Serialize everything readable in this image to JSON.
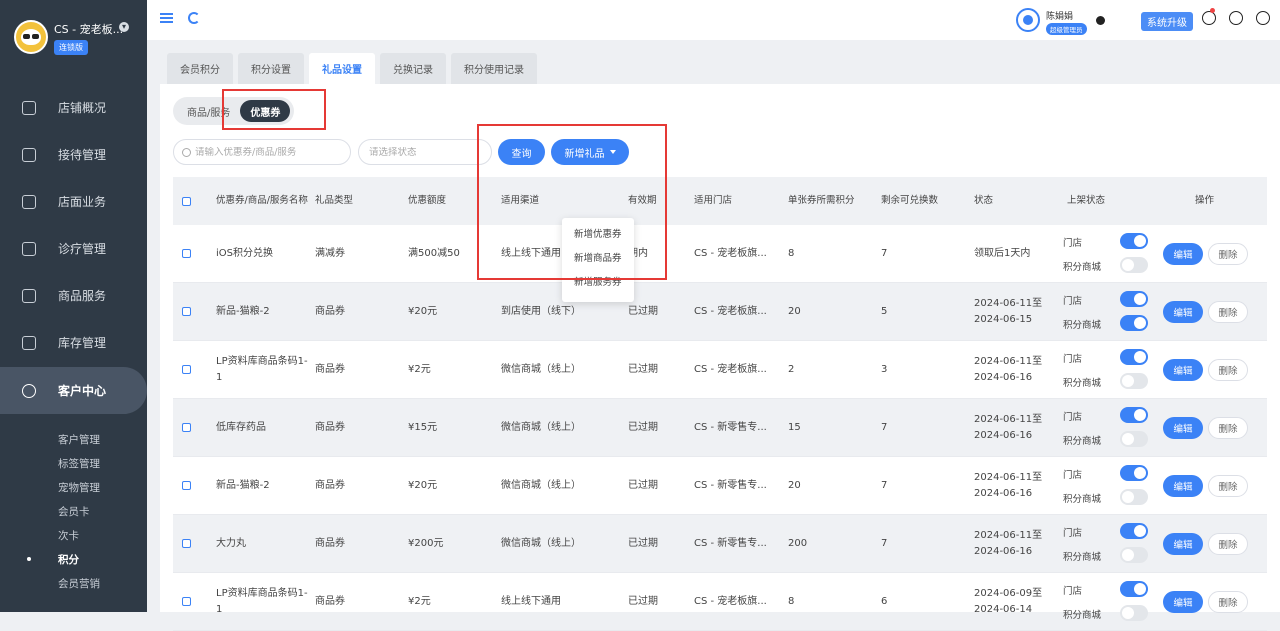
{
  "sidebar": {
    "store_name": "CS - 宠老板...",
    "chain_badge": "连锁版",
    "nav": [
      {
        "label": "店铺概况",
        "icon": "monitor-icon"
      },
      {
        "label": "接待管理",
        "icon": "clipboard-icon"
      },
      {
        "label": "店面业务",
        "icon": "home-icon"
      },
      {
        "label": "诊疗管理",
        "icon": "medical-kit-icon"
      },
      {
        "label": "商品服务",
        "icon": "shopping-bag-icon"
      },
      {
        "label": "库存管理",
        "icon": "box-icon"
      },
      {
        "label": "客户中心",
        "icon": "customer-icon"
      }
    ],
    "sub_items": [
      "客户管理",
      "标签管理",
      "宠物管理",
      "会员卡",
      "次卡",
      "积分",
      "会员营销"
    ]
  },
  "topbar": {
    "user_name": "陈娟娟",
    "user_role": "超级管理员",
    "upgrade_label": "系统升级"
  },
  "tabs": [
    "会员积分",
    "积分设置",
    "礼品设置",
    "兑换记录",
    "积分使用记录"
  ],
  "segment": [
    "商品/服务",
    "优惠券"
  ],
  "filters": {
    "search_placeholder": "请输入优惠券/商品/服务",
    "status_placeholder": "请选择状态",
    "query_label": "查询",
    "add_gift_label": "新增礼品"
  },
  "dropdown": [
    "新增优惠券",
    "新增商品券",
    "新增服务券"
  ],
  "table": {
    "headers": [
      "优惠券/商品/服务名称",
      "礼品类型",
      "优惠额度",
      "适用渠道",
      "有效期",
      "适用门店",
      "单张券所需积分",
      "剩余可兑换数",
      "状态",
      "上架状态",
      "操作"
    ],
    "row_labels": {
      "store": "门店",
      "mall": "积分商城",
      "edit": "编辑",
      "delete": "删除"
    },
    "rows": [
      {
        "name": "iOS积分兑换",
        "type": "满减券",
        "amount": "满500减50",
        "channel": "线上线下通用",
        "validity": "期内",
        "store": "CS - 宠老板旗...",
        "points": "8",
        "remaining": "7",
        "status": "领取后1天内",
        "store_on": true,
        "mall_on": false
      },
      {
        "name": "新品-猫粮-2",
        "type": "商品券",
        "amount": "¥20元",
        "channel": "到店使用（线下）",
        "validity": "已过期",
        "store": "CS - 宠老板旗...",
        "points": "20",
        "remaining": "5",
        "status": "2024-06-11至2024-06-15",
        "store_on": true,
        "mall_on": true
      },
      {
        "name": "LP资料库商品条码1-1",
        "type": "商品券",
        "amount": "¥2元",
        "channel": "微信商城（线上）",
        "validity": "已过期",
        "store": "CS - 宠老板旗...",
        "points": "2",
        "remaining": "3",
        "status": "2024-06-11至2024-06-16",
        "store_on": true,
        "mall_on": false
      },
      {
        "name": "低库存药品",
        "type": "商品券",
        "amount": "¥15元",
        "channel": "微信商城（线上）",
        "validity": "已过期",
        "store": "CS - 新零售专...",
        "points": "15",
        "remaining": "7",
        "status": "2024-06-11至2024-06-16",
        "store_on": true,
        "mall_on": false
      },
      {
        "name": "新品-猫粮-2",
        "type": "商品券",
        "amount": "¥20元",
        "channel": "微信商城（线上）",
        "validity": "已过期",
        "store": "CS - 新零售专...",
        "points": "20",
        "remaining": "7",
        "status": "2024-06-11至2024-06-16",
        "store_on": true,
        "mall_on": false
      },
      {
        "name": "大力丸",
        "type": "商品券",
        "amount": "¥200元",
        "channel": "微信商城（线上）",
        "validity": "已过期",
        "store": "CS - 新零售专...",
        "points": "200",
        "remaining": "7",
        "status": "2024-06-11至2024-06-16",
        "store_on": true,
        "mall_on": false
      },
      {
        "name": "LP资料库商品条码1-1",
        "type": "商品券",
        "amount": "¥2元",
        "channel": "线上线下通用",
        "validity": "已过期",
        "store": "CS - 宠老板旗...",
        "points": "8",
        "remaining": "6",
        "status": "2024-06-09至2024-06-14",
        "store_on": true,
        "mall_on": false
      }
    ]
  },
  "colors": {
    "primary": "#3b82f6",
    "sidebar_bg": "#2f3a46",
    "highlight": "#e53935"
  }
}
